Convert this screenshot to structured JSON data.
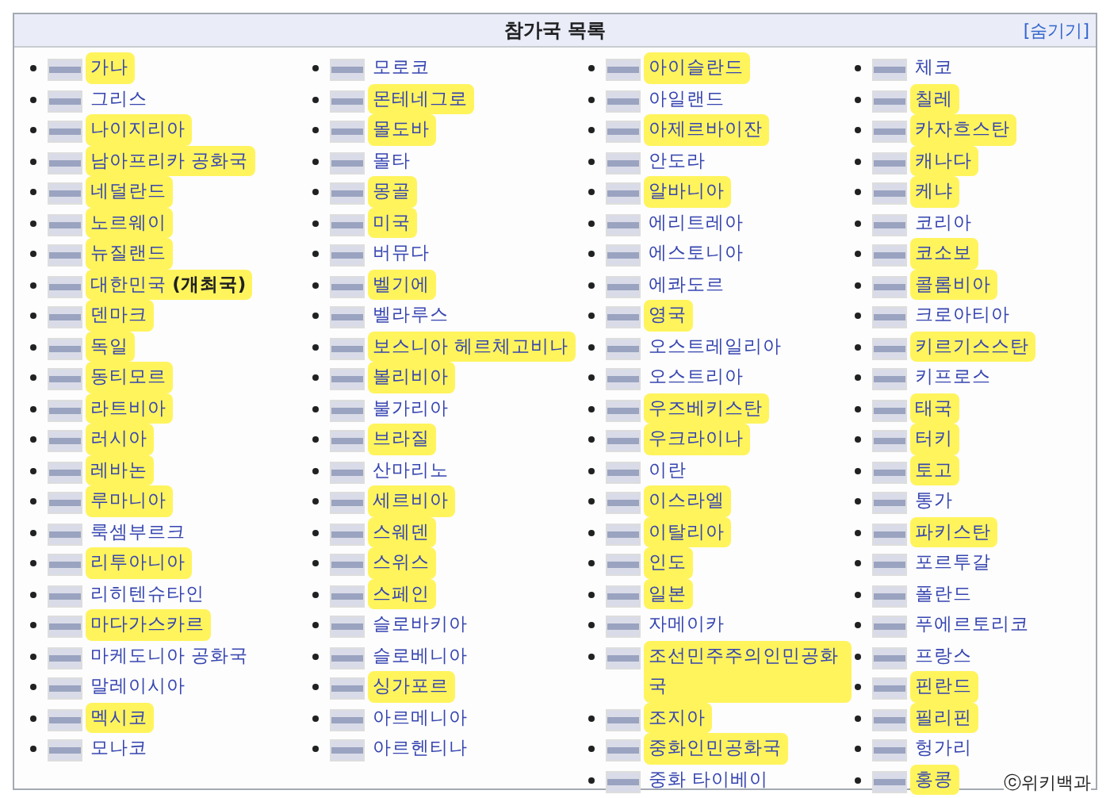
{
  "navbox": {
    "title": "참가국 목록",
    "toggle": "[숨기기]"
  },
  "columns": [
    [
      {
        "label": "가나",
        "highlighted": true
      },
      {
        "label": "그리스",
        "highlighted": false
      },
      {
        "label": "나이지리아",
        "highlighted": true
      },
      {
        "label": "남아프리카 공화국",
        "highlighted": true
      },
      {
        "label": "네덜란드",
        "highlighted": true
      },
      {
        "label": "노르웨이",
        "highlighted": true
      },
      {
        "label": "뉴질랜드",
        "highlighted": true
      },
      {
        "label": "대한민국 **(개최국)**",
        "highlighted": true
      },
      {
        "label": "덴마크",
        "highlighted": true
      },
      {
        "label": "독일",
        "highlighted": true
      },
      {
        "label": "동티모르",
        "highlighted": true
      },
      {
        "label": "라트비아",
        "highlighted": true
      },
      {
        "label": "러시아",
        "highlighted": true
      },
      {
        "label": "레바논",
        "highlighted": true
      },
      {
        "label": "루마니아",
        "highlighted": true
      },
      {
        "label": "룩셈부르크",
        "highlighted": false
      },
      {
        "label": "리투아니아",
        "highlighted": true
      },
      {
        "label": "리히텐슈타인",
        "highlighted": false
      },
      {
        "label": "마다가스카르",
        "highlighted": true
      },
      {
        "label": "마케도니아 공화국",
        "highlighted": false
      },
      {
        "label": "말레이시아",
        "highlighted": false
      },
      {
        "label": "멕시코",
        "highlighted": true
      },
      {
        "label": "모나코",
        "highlighted": false
      }
    ],
    [
      {
        "label": "모로코",
        "highlighted": false
      },
      {
        "label": "몬테네그로",
        "highlighted": true
      },
      {
        "label": "몰도바",
        "highlighted": true
      },
      {
        "label": "몰타",
        "highlighted": false
      },
      {
        "label": "몽골",
        "highlighted": true
      },
      {
        "label": "미국",
        "highlighted": true
      },
      {
        "label": "버뮤다",
        "highlighted": false
      },
      {
        "label": "벨기에",
        "highlighted": true
      },
      {
        "label": "벨라루스",
        "highlighted": false
      },
      {
        "label": "보스니아 헤르체고비나",
        "highlighted": true
      },
      {
        "label": "볼리비아",
        "highlighted": true
      },
      {
        "label": "불가리아",
        "highlighted": false
      },
      {
        "label": "브라질",
        "highlighted": true
      },
      {
        "label": "산마리노",
        "highlighted": false
      },
      {
        "label": "세르비아",
        "highlighted": true
      },
      {
        "label": "스웨덴",
        "highlighted": true
      },
      {
        "label": "스위스",
        "highlighted": true
      },
      {
        "label": "스페인",
        "highlighted": true
      },
      {
        "label": "슬로바키아",
        "highlighted": false
      },
      {
        "label": "슬로베니아",
        "highlighted": false
      },
      {
        "label": "싱가포르",
        "highlighted": true
      },
      {
        "label": "아르메니아",
        "highlighted": false
      },
      {
        "label": "아르헨티나",
        "highlighted": false
      }
    ],
    [
      {
        "label": "아이슬란드",
        "highlighted": true
      },
      {
        "label": "아일랜드",
        "highlighted": false
      },
      {
        "label": "아제르바이잔",
        "highlighted": true
      },
      {
        "label": "안도라",
        "highlighted": false
      },
      {
        "label": "알바니아",
        "highlighted": true
      },
      {
        "label": "에리트레아",
        "highlighted": false
      },
      {
        "label": "에스토니아",
        "highlighted": false
      },
      {
        "label": "에콰도르",
        "highlighted": false
      },
      {
        "label": "영국",
        "highlighted": true
      },
      {
        "label": "오스트레일리아",
        "highlighted": false
      },
      {
        "label": "오스트리아",
        "highlighted": false
      },
      {
        "label": "우즈베키스탄",
        "highlighted": true
      },
      {
        "label": "우크라이나",
        "highlighted": true
      },
      {
        "label": "이란",
        "highlighted": false
      },
      {
        "label": "이스라엘",
        "highlighted": true
      },
      {
        "label": "이탈리아",
        "highlighted": true
      },
      {
        "label": "인도",
        "highlighted": true
      },
      {
        "label": "일본",
        "highlighted": true
      },
      {
        "label": "자메이카",
        "highlighted": false
      },
      {
        "label": "조선민주주의인민공화국",
        "highlighted": true
      },
      {
        "label": "조지아",
        "highlighted": true
      },
      {
        "label": "중화인민공화국",
        "highlighted": true
      },
      {
        "label": "중화 타이베이",
        "highlighted": false
      }
    ],
    [
      {
        "label": "체코",
        "highlighted": false
      },
      {
        "label": "칠레",
        "highlighted": true
      },
      {
        "label": "카자흐스탄",
        "highlighted": true
      },
      {
        "label": "캐나다",
        "highlighted": true
      },
      {
        "label": "케냐",
        "highlighted": true
      },
      {
        "label": "코리아",
        "highlighted": false
      },
      {
        "label": "코소보",
        "highlighted": true
      },
      {
        "label": "콜롬비아",
        "highlighted": true
      },
      {
        "label": "크로아티아",
        "highlighted": false
      },
      {
        "label": "키르기스스탄",
        "highlighted": true
      },
      {
        "label": "키프로스",
        "highlighted": false
      },
      {
        "label": "태국",
        "highlighted": true
      },
      {
        "label": "터키",
        "highlighted": true
      },
      {
        "label": "토고",
        "highlighted": true
      },
      {
        "label": "통가",
        "highlighted": false
      },
      {
        "label": "파키스탄",
        "highlighted": true
      },
      {
        "label": "포르투갈",
        "highlighted": false
      },
      {
        "label": "폴란드",
        "highlighted": false
      },
      {
        "label": "푸에르토리코",
        "highlighted": false
      },
      {
        "label": "프랑스",
        "highlighted": false
      },
      {
        "label": "핀란드",
        "highlighted": true
      },
      {
        "label": "필리핀",
        "highlighted": true
      },
      {
        "label": "헝가리",
        "highlighted": false
      },
      {
        "label": "홍콩",
        "highlighted": true
      }
    ]
  ],
  "footer": "ⓒ위키백과"
}
